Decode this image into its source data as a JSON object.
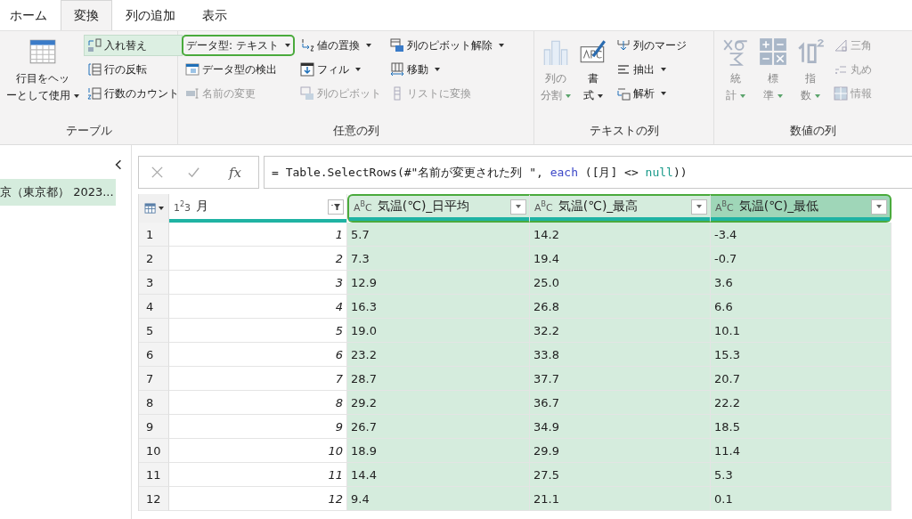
{
  "tabs": [
    {
      "label": "ホーム",
      "selected": false
    },
    {
      "label": "変換",
      "selected": true
    },
    {
      "label": "列の追加",
      "selected": false
    },
    {
      "label": "表示",
      "selected": false
    }
  ],
  "ribbon": {
    "groups": [
      {
        "label": "テーブル",
        "columns": [
          {
            "kind": "large",
            "buttons": [
              {
                "lines": [
                  "行目をヘッ",
                  "ーとして使用"
                ],
                "dropdown": true,
                "disabled": false
              }
            ]
          },
          {
            "kind": "stack",
            "buttons": [
              {
                "label": "入れ替え",
                "dropdown": false,
                "disabled": false,
                "highlighted": true
              },
              {
                "label": "行の反転",
                "dropdown": false,
                "disabled": false,
                "highlighted": false
              },
              {
                "label": "行数のカウント",
                "dropdown": false,
                "disabled": false,
                "highlighted": false
              }
            ]
          }
        ]
      },
      {
        "label": "任意の列",
        "columns": [
          {
            "kind": "stack",
            "buttons": [
              {
                "label": "データ型: テキスト",
                "dropdown": true,
                "disabled": false,
                "outlined": true
              },
              {
                "label": "データ型の検出",
                "dropdown": false,
                "disabled": false,
                "outlined": false
              },
              {
                "label": "名前の変更",
                "dropdown": false,
                "disabled": true,
                "outlined": false
              }
            ]
          },
          {
            "kind": "stack",
            "buttons": [
              {
                "label": "値の置換",
                "dropdown": true,
                "disabled": false
              },
              {
                "label": "フィル",
                "dropdown": true,
                "disabled": false
              },
              {
                "label": "列のピボット",
                "dropdown": false,
                "disabled": true
              }
            ]
          },
          {
            "kind": "stack",
            "buttons": [
              {
                "label": "列のピボット解除",
                "dropdown": true,
                "disabled": false
              },
              {
                "label": "移動",
                "dropdown": true,
                "disabled": false
              },
              {
                "label": "リストに変換",
                "dropdown": false,
                "disabled": true
              }
            ]
          }
        ]
      },
      {
        "label": "テキストの列",
        "columns": [
          {
            "kind": "large",
            "buttons": [
              {
                "lines": [
                  "列の",
                  "分割"
                ],
                "dropdown": true,
                "disabled": true
              }
            ]
          },
          {
            "kind": "large",
            "buttons": [
              {
                "lines": [
                  "書",
                  "式"
                ],
                "dropdown": true,
                "disabled": false
              }
            ]
          },
          {
            "kind": "stack",
            "buttons": [
              {
                "label": "列のマージ",
                "dropdown": false,
                "disabled": false
              },
              {
                "label": "抽出",
                "dropdown": true,
                "disabled": false
              },
              {
                "label": "解析",
                "dropdown": true,
                "disabled": false
              }
            ]
          }
        ]
      },
      {
        "label": "数値の列",
        "columns": [
          {
            "kind": "large",
            "buttons": [
              {
                "lines": [
                  "統",
                  "計"
                ],
                "dropdown": true,
                "disabled": true
              }
            ]
          },
          {
            "kind": "large",
            "buttons": [
              {
                "lines": [
                  "標",
                  "準"
                ],
                "dropdown": true,
                "disabled": true
              }
            ]
          },
          {
            "kind": "large",
            "buttons": [
              {
                "lines": [
                  "指",
                  "数"
                ],
                "dropdown": true,
                "disabled": true
              }
            ]
          },
          {
            "kind": "stack",
            "buttons": [
              {
                "label": "三角",
                "dropdown": false,
                "disabled": true
              },
              {
                "label": "丸め",
                "dropdown": false,
                "disabled": true
              },
              {
                "label": "情報",
                "dropdown": false,
                "disabled": true
              }
            ]
          }
        ]
      }
    ]
  },
  "queries": {
    "items": [
      {
        "label": "京（東京都） 2023...",
        "selected": true
      }
    ]
  },
  "formula_bar": {
    "fx": "fx",
    "formula": [
      {
        "kind": "plain",
        "text": "= Table.SelectRows(#\"名前が変更された列 \", "
      },
      {
        "kind": "keyword",
        "text": "each"
      },
      {
        "kind": "plain",
        "text": " ([月] <> "
      },
      {
        "kind": "literal",
        "text": "null"
      },
      {
        "kind": "plain",
        "text": "))"
      }
    ]
  },
  "table": {
    "columns": [
      {
        "name": "月",
        "type_label": "1$^{2}$3",
        "kind": "number",
        "filtered": true,
        "selected": false,
        "focused": false,
        "outlined": false
      },
      {
        "name": "気温(℃)_日平均",
        "type_label": "A$^{B}$C",
        "kind": "text",
        "filtered": false,
        "selected": true,
        "focused": false,
        "outlined": true
      },
      {
        "name": "気温(℃)_最高",
        "type_label": "A$^{B}$C",
        "kind": "text",
        "filtered": false,
        "selected": true,
        "focused": false,
        "outlined": true
      },
      {
        "name": "気温(℃)_最低",
        "type_label": "A$^{B}$C",
        "kind": "text",
        "filtered": false,
        "selected": true,
        "focused": true,
        "outlined": true
      }
    ],
    "rows": [
      {
        "number": "1",
        "cells": [
          "1",
          "5.7",
          "14.2",
          "-3.4"
        ]
      },
      {
        "number": "2",
        "cells": [
          "2",
          "7.3",
          "19.4",
          "-0.7"
        ]
      },
      {
        "number": "3",
        "cells": [
          "3",
          "12.9",
          "25.0",
          "3.6"
        ]
      },
      {
        "number": "4",
        "cells": [
          "4",
          "16.3",
          "26.8",
          "6.6"
        ]
      },
      {
        "number": "5",
        "cells": [
          "5",
          "19.0",
          "32.2",
          "10.1"
        ]
      },
      {
        "number": "6",
        "cells": [
          "6",
          "23.2",
          "33.8",
          "15.3"
        ]
      },
      {
        "number": "7",
        "cells": [
          "7",
          "28.7",
          "37.7",
          "20.7"
        ]
      },
      {
        "number": "8",
        "cells": [
          "8",
          "29.2",
          "36.7",
          "22.2"
        ]
      },
      {
        "number": "9",
        "cells": [
          "9",
          "26.7",
          "34.9",
          "18.5"
        ]
      },
      {
        "number": "10",
        "cells": [
          "10",
          "18.9",
          "29.9",
          "11.4"
        ]
      },
      {
        "number": "11",
        "cells": [
          "11",
          "14.4",
          "27.5",
          "5.3"
        ]
      },
      {
        "number": "12",
        "cells": [
          "12",
          "9.4",
          "21.1",
          "0.1"
        ]
      }
    ]
  }
}
